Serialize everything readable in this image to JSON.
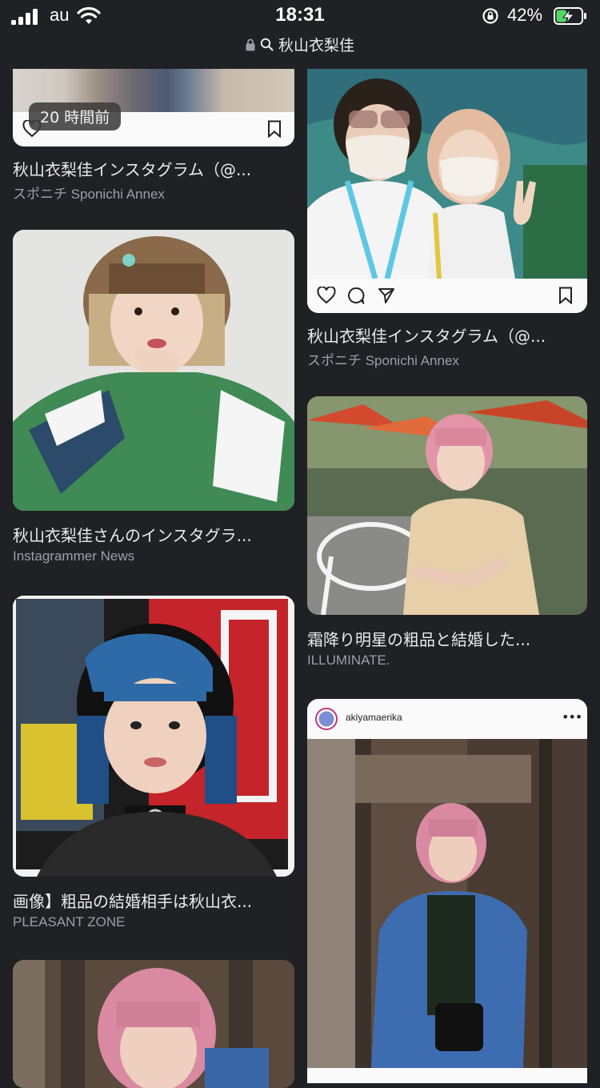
{
  "status_bar": {
    "carrier": "au",
    "time": "18:31",
    "battery_percent": "42%",
    "battery_level": 0.42
  },
  "url_bar": {
    "query": "秋山衣梨佳"
  },
  "results": [
    {
      "caption": "秋山衣梨佳インスタグラム（@...",
      "source": "スポニチ Sponichi Annex",
      "badge": "20 時間前"
    },
    {
      "caption": "秋山衣梨佳インスタグラム（@...",
      "source": "スポニチ Sponichi Annex"
    },
    {
      "caption": "秋山衣梨佳さんのインスタグラ...",
      "source": "Instagrammer News"
    },
    {
      "caption": "霜降り明星の粗品と結婚した...",
      "source": "ILLUMINATE."
    },
    {
      "caption": "画像】粗品の結婚相手は秋山衣...",
      "source": "PLEASANT ZONE"
    },
    {
      "username": "akiyamaerika"
    }
  ],
  "colors": {
    "background": "#202124",
    "caption": "#e8eaed",
    "source": "#9aa0a6",
    "battery_fill": "#4cd964"
  }
}
